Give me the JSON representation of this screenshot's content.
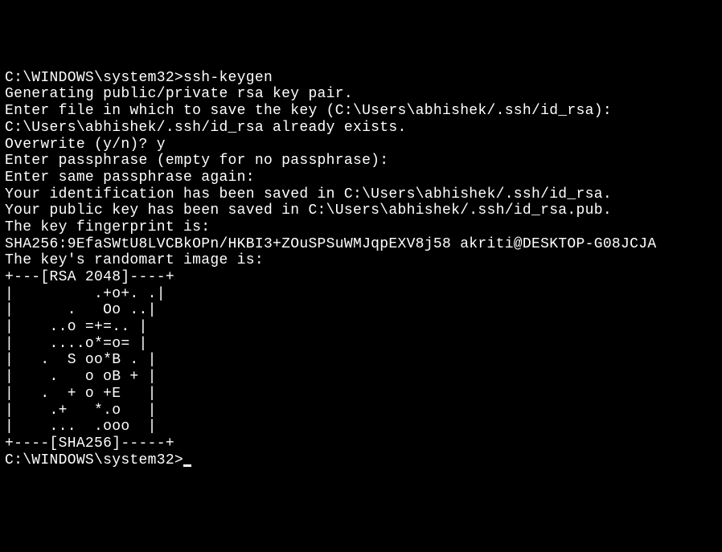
{
  "terminal": {
    "lines": [
      "C:\\WINDOWS\\system32>ssh-keygen",
      "Generating public/private rsa key pair.",
      "Enter file in which to save the key (C:\\Users\\abhishek/.ssh/id_rsa):",
      "C:\\Users\\abhishek/.ssh/id_rsa already exists.",
      "Overwrite (y/n)? y",
      "Enter passphrase (empty for no passphrase):",
      "Enter same passphrase again:",
      "Your identification has been saved in C:\\Users\\abhishek/.ssh/id_rsa.",
      "Your public key has been saved in C:\\Users\\abhishek/.ssh/id_rsa.pub.",
      "The key fingerprint is:",
      "SHA256:9EfaSWtU8LVCBkOPn/HKBI3+ZOuSPSuWMJqpEXV8j58 akriti@DESKTOP-G08JCJA",
      "The key's randomart image is:",
      "+---[RSA 2048]----+",
      "|         .+o+. .|",
      "|      .   Oo ..|",
      "|    ..o =+=.. |",
      "|    ....o*=o= |",
      "|   .  S oo*B . |",
      "|    .   o oB + |",
      "|   .  + o +E   |",
      "|    .+   *.o   |",
      "|    ...  .ooo  |",
      "+----[SHA256]-----+",
      "",
      "C:\\WINDOWS\\system32>"
    ]
  }
}
